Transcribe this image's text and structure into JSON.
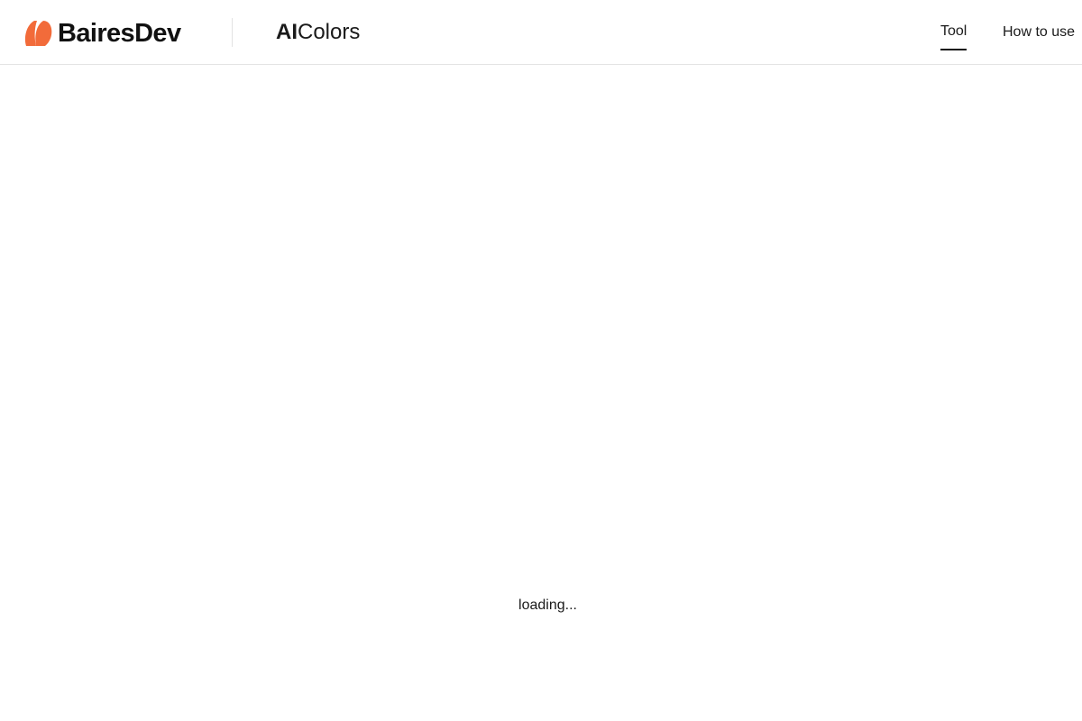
{
  "brand": {
    "name": "BairesDev",
    "accent_color": "#f26b3a",
    "icon": "bairesdev-logo-icon"
  },
  "product": {
    "title_bold": "AI",
    "title_regular": "Colors"
  },
  "nav": {
    "items": [
      {
        "label": "Tool",
        "active": true
      },
      {
        "label": "How to use",
        "active": false
      }
    ]
  },
  "main": {
    "status_text": "loading..."
  }
}
